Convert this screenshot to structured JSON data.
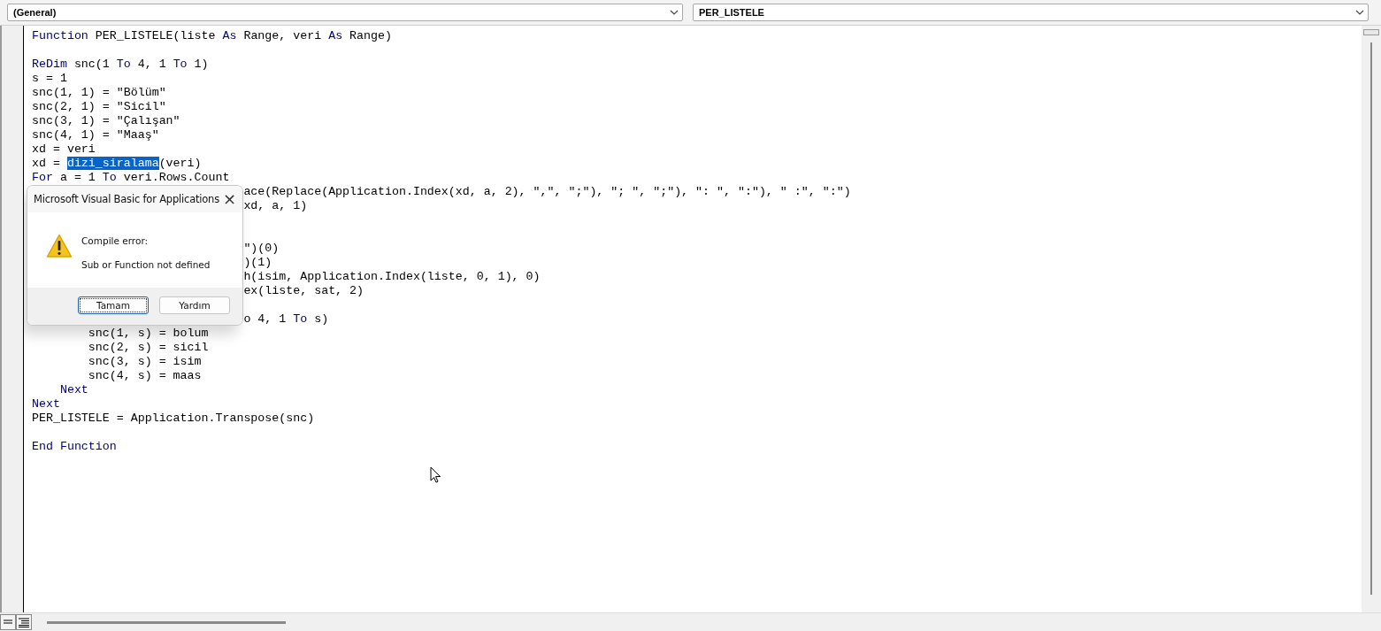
{
  "object_box": {
    "value": "(General)"
  },
  "procedure_box": {
    "value": "PER_LISTELE"
  },
  "code_lines": [
    {
      "kind": "code",
      "segments": [
        {
          "kind": "keyword",
          "text": "Function"
        },
        {
          "kind": "plain",
          "text": " PER_LISTELE(liste "
        },
        {
          "kind": "keyword",
          "text": "As"
        },
        {
          "kind": "plain",
          "text": " Range, veri "
        },
        {
          "kind": "keyword",
          "text": "As"
        },
        {
          "kind": "plain",
          "text": " Range)"
        }
      ]
    },
    {
      "kind": "blank"
    },
    {
      "kind": "code",
      "segments": [
        {
          "kind": "keyword",
          "text": "ReDim"
        },
        {
          "kind": "plain",
          "text": " snc(1 "
        },
        {
          "kind": "keyword",
          "text": "To"
        },
        {
          "kind": "plain",
          "text": " 4, 1 "
        },
        {
          "kind": "keyword",
          "text": "To"
        },
        {
          "kind": "plain",
          "text": " 1)"
        }
      ]
    },
    {
      "kind": "code",
      "segments": [
        {
          "kind": "plain",
          "text": "s = 1"
        }
      ]
    },
    {
      "kind": "code",
      "segments": [
        {
          "kind": "plain",
          "text": "snc(1, 1) = \"Bölüm\""
        }
      ]
    },
    {
      "kind": "code",
      "segments": [
        {
          "kind": "plain",
          "text": "snc(2, 1) = \"Sicil\""
        }
      ]
    },
    {
      "kind": "code",
      "segments": [
        {
          "kind": "plain",
          "text": "snc(3, 1) = \"Çalışan\""
        }
      ]
    },
    {
      "kind": "code",
      "segments": [
        {
          "kind": "plain",
          "text": "snc(4, 1) = \"Maaş\""
        }
      ]
    },
    {
      "kind": "code",
      "segments": [
        {
          "kind": "plain",
          "text": "xd = veri"
        }
      ]
    },
    {
      "kind": "code",
      "segments": [
        {
          "kind": "plain",
          "text": "xd = "
        },
        {
          "kind": "selected",
          "text": "dizi_siralama"
        },
        {
          "kind": "plain",
          "text": "(veri)"
        }
      ]
    },
    {
      "kind": "code",
      "segments": [
        {
          "kind": "keyword",
          "text": "For"
        },
        {
          "kind": "plain",
          "text": " a = 1 "
        },
        {
          "kind": "keyword",
          "text": "To"
        },
        {
          "kind": "plain",
          "text": " veri.Rows.Count"
        }
      ]
    },
    {
      "kind": "code",
      "segments": [
        {
          "kind": "plain",
          "text": "                              ace(Replace(Application.Index(xd, a, 2), \",\", \";\"), \"; \", \";\"), \": \", \":\"), \" :\", \":\")"
        }
      ]
    },
    {
      "kind": "code",
      "segments": [
        {
          "kind": "plain",
          "text": "                              xd, a, 1)"
        }
      ]
    },
    {
      "kind": "blank"
    },
    {
      "kind": "blank"
    },
    {
      "kind": "code",
      "segments": [
        {
          "kind": "plain",
          "text": "                              \")(0)"
        }
      ]
    },
    {
      "kind": "code",
      "segments": [
        {
          "kind": "plain",
          "text": "                              )(1)"
        }
      ]
    },
    {
      "kind": "code",
      "segments": [
        {
          "kind": "plain",
          "text": "                              h(isim, Application.Index(liste, 0, 1), 0)"
        }
      ]
    },
    {
      "kind": "code",
      "segments": [
        {
          "kind": "plain",
          "text": "                              ex(liste, sat, 2)"
        }
      ]
    },
    {
      "kind": "blank"
    },
    {
      "kind": "code",
      "segments": [
        {
          "kind": "plain",
          "text": "                              o 4, 1 "
        },
        {
          "kind": "keyword",
          "text": "To"
        },
        {
          "kind": "plain",
          "text": " s)"
        }
      ]
    },
    {
      "kind": "code",
      "segments": [
        {
          "kind": "plain",
          "text": "        snc(1, s) = bolum"
        }
      ]
    },
    {
      "kind": "code",
      "segments": [
        {
          "kind": "plain",
          "text": "        snc(2, s) = sicil"
        }
      ]
    },
    {
      "kind": "code",
      "segments": [
        {
          "kind": "plain",
          "text": "        snc(3, s) = isim"
        }
      ]
    },
    {
      "kind": "code",
      "segments": [
        {
          "kind": "plain",
          "text": "        snc(4, s) = maas"
        }
      ]
    },
    {
      "kind": "code",
      "segments": [
        {
          "kind": "keyword",
          "text": "    Next"
        }
      ]
    },
    {
      "kind": "code",
      "segments": [
        {
          "kind": "keyword",
          "text": "Next"
        }
      ]
    },
    {
      "kind": "code",
      "segments": [
        {
          "kind": "plain",
          "text": "PER_LISTELE = Application.Transpose(snc)"
        }
      ]
    },
    {
      "kind": "blank"
    },
    {
      "kind": "code",
      "segments": [
        {
          "kind": "keyword",
          "text": "End Function"
        }
      ]
    }
  ],
  "dialog": {
    "title": "Microsoft Visual Basic for Applications",
    "close": "×",
    "heading": "Compile error:",
    "message": "Sub or Function not defined",
    "buttons": [
      {
        "label": "Tamam",
        "selected": true
      },
      {
        "label": "Yardım",
        "selected": false
      }
    ]
  }
}
